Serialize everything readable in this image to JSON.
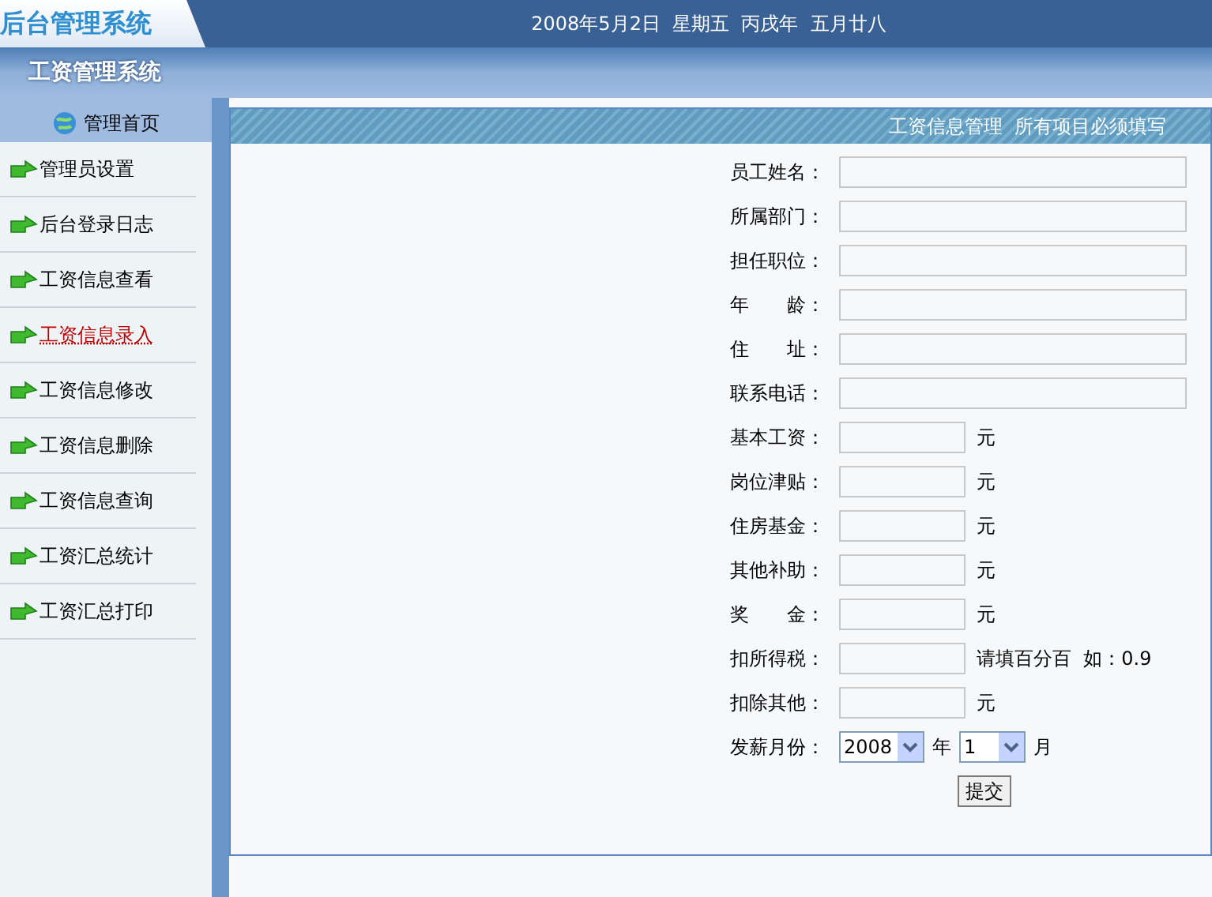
{
  "header": {
    "logo": "后台管理系统",
    "date": "2008年5月2日  星期五  丙戌年  五月廿八"
  },
  "band": {
    "title": "工资管理系统"
  },
  "sidebar": {
    "home": "管理首页",
    "items": [
      {
        "label": "管理员设置",
        "selected": false
      },
      {
        "label": "后台登录日志",
        "selected": false
      },
      {
        "label": "工资信息查看",
        "selected": false
      },
      {
        "label": "工资信息录入",
        "selected": true
      },
      {
        "label": "工资信息修改",
        "selected": false
      },
      {
        "label": "工资信息删除",
        "selected": false
      },
      {
        "label": "工资信息查询",
        "selected": false
      },
      {
        "label": "工资汇总统计",
        "selected": false
      },
      {
        "label": "工资汇总打印",
        "selected": false
      }
    ]
  },
  "panel": {
    "title": "工资信息管理  所有项目必须填写",
    "fields": [
      {
        "kind": "wide",
        "label": "员工姓名："
      },
      {
        "kind": "wide",
        "label": "所属部门："
      },
      {
        "kind": "wide",
        "label": "担任职位："
      },
      {
        "kind": "wide",
        "label": "年　　龄："
      },
      {
        "kind": "wide",
        "label": "住　　址："
      },
      {
        "kind": "wide",
        "label": "联系电话："
      },
      {
        "kind": "short",
        "label": "基本工资：",
        "suffix": "元"
      },
      {
        "kind": "short",
        "label": "岗位津贴：",
        "suffix": "元"
      },
      {
        "kind": "short",
        "label": "住房基金：",
        "suffix": "元"
      },
      {
        "kind": "short",
        "label": "其他补助：",
        "suffix": "元"
      },
      {
        "kind": "short",
        "label": "奖　　金：",
        "suffix": "元"
      },
      {
        "kind": "short",
        "label": "扣所得税：",
        "suffix": "请填百分百  如：0.9"
      },
      {
        "kind": "short",
        "label": "扣除其他：",
        "suffix": "元"
      }
    ],
    "month": {
      "label": "发薪月份：",
      "year": "2008",
      "year_unit": "年",
      "month": "1",
      "month_unit": "月"
    },
    "submit": "提交"
  }
}
